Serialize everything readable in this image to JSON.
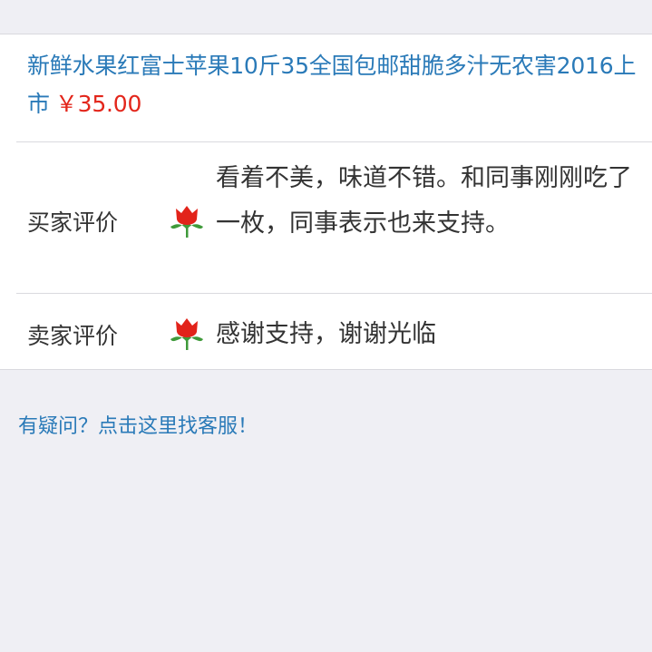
{
  "product": {
    "title": "新鲜水果红富士苹果10斤35全国包邮甜脆多汁无农害2016上市",
    "price": "￥35.00"
  },
  "reviews": [
    {
      "label": "买家评价",
      "rating_icon": "red-flower-icon",
      "text": "看着不美，味道不错。和同事刚刚吃了一枚，同事表示也来支持。"
    },
    {
      "label": "卖家评价",
      "rating_icon": "red-flower-icon",
      "text": "感谢支持，谢谢光临"
    }
  ],
  "help": {
    "link_text": "有疑问？点击这里找客服！"
  },
  "colors": {
    "link": "#2a7ab8",
    "price": "#e3261b",
    "background": "#efeff4"
  }
}
